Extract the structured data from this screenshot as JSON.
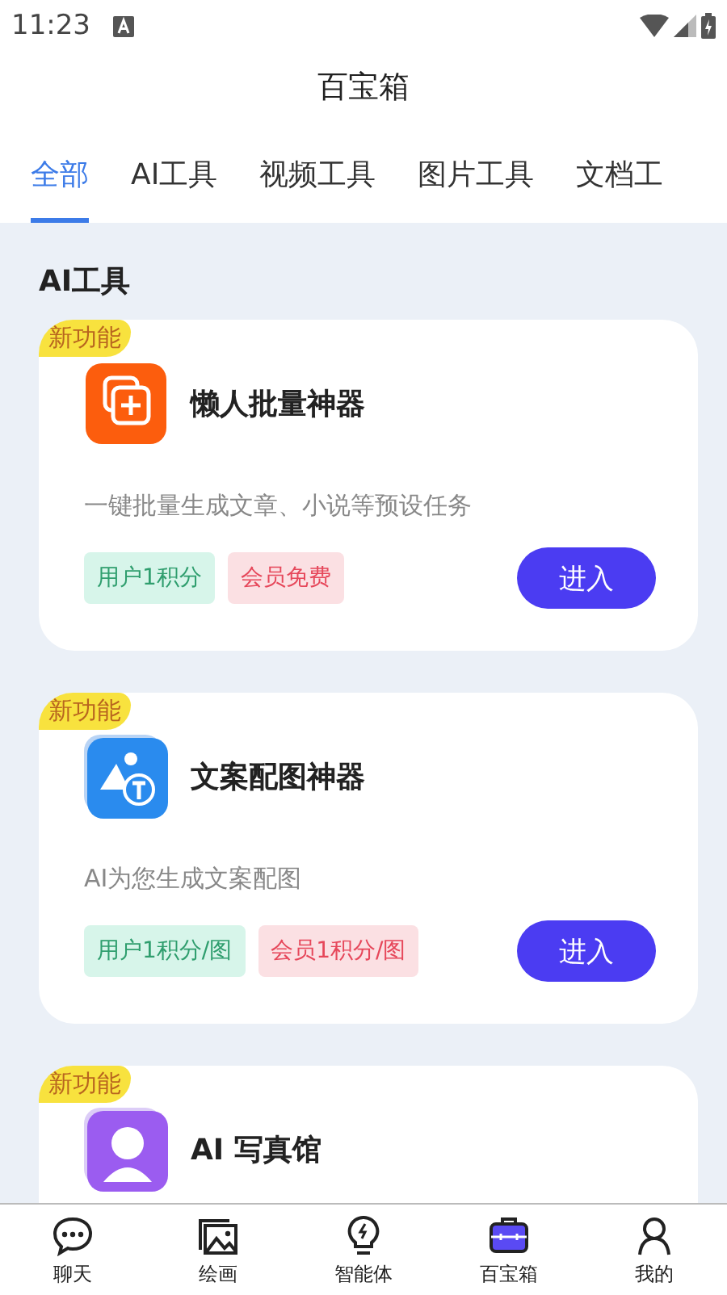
{
  "status_bar": {
    "time": "11:23"
  },
  "header": {
    "title": "百宝箱"
  },
  "tabs": [
    {
      "label": "全部",
      "selected": true
    },
    {
      "label": "AI工具",
      "selected": false
    },
    {
      "label": "视频工具",
      "selected": false
    },
    {
      "label": "图片工具",
      "selected": false
    },
    {
      "label": "文档工",
      "selected": false
    }
  ],
  "section": {
    "title": "AI工具"
  },
  "cards": [
    {
      "badge": "新功能",
      "kind": "batch",
      "title": "懒人批量神器",
      "description": "一键批量生成文章、小说等预设任务",
      "tags": [
        {
          "kind": "user",
          "label": "用户1积分"
        },
        {
          "kind": "member",
          "label": "会员免费"
        }
      ],
      "button": "进入"
    },
    {
      "badge": "新功能",
      "kind": "image",
      "title": "文案配图神器",
      "description": "AI为您生成文案配图",
      "tags": [
        {
          "kind": "user",
          "label": "用户1积分/图"
        },
        {
          "kind": "member",
          "label": "会员1积分/图"
        }
      ],
      "button": "进入"
    },
    {
      "badge": "新功能",
      "kind": "portrait",
      "title": "AI 写真馆"
    }
  ],
  "bottom_nav": [
    {
      "kind": "chat",
      "label": "聊天",
      "selected": false
    },
    {
      "kind": "picture",
      "label": "绘画",
      "selected": false
    },
    {
      "kind": "bulb",
      "label": "智能体",
      "selected": false
    },
    {
      "kind": "toolbox",
      "label": "百宝箱",
      "selected": true
    },
    {
      "kind": "person",
      "label": "我的",
      "selected": false
    }
  ]
}
